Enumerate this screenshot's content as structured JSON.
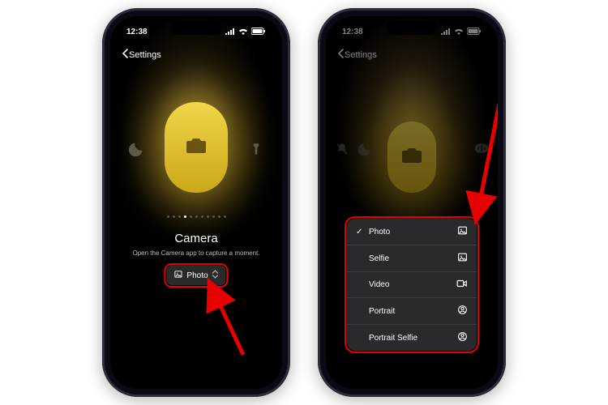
{
  "status": {
    "time": "12:38"
  },
  "nav": {
    "back": "Settings"
  },
  "hero": {
    "title": "Camera",
    "subtitle": "Open the Camera app to capture a moment.",
    "selected_label": "Photo"
  },
  "pager": {
    "count": 11,
    "active_index": 3
  },
  "menu": {
    "items": [
      {
        "label": "Photo",
        "trailing": "image-icon",
        "checked": true
      },
      {
        "label": "Selfie",
        "trailing": "image-icon",
        "checked": false
      },
      {
        "label": "Video",
        "trailing": "video-icon",
        "checked": false
      },
      {
        "label": "Portrait",
        "trailing": "person-icon",
        "checked": false
      },
      {
        "label": "Portrait Selfie",
        "trailing": "person-icon",
        "checked": false
      }
    ]
  },
  "colors": {
    "accent": "#e3bd2d",
    "highlight": "#e60000"
  }
}
